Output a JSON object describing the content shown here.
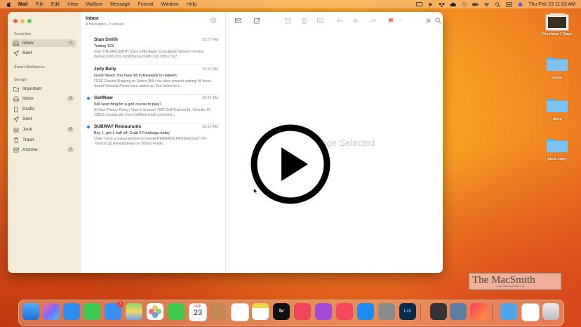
{
  "menubar": {
    "app": "Mail",
    "menus": [
      "File",
      "Edit",
      "View",
      "Mailbox",
      "Message",
      "Format",
      "Window",
      "Help"
    ],
    "clock": "Thu Feb 23  11:03 AM"
  },
  "sidebar": {
    "favorites_label": "Favorites",
    "favorites": [
      {
        "label": "Inbox",
        "badge": "2",
        "icon": "tray-icon"
      },
      {
        "label": "Sent",
        "badge": "",
        "icon": "paperplane-icon"
      }
    ],
    "smart_label": "Smart Mailboxes",
    "google_label": "Google",
    "google": [
      {
        "label": "Important",
        "badge": "",
        "icon": "folder-icon"
      },
      {
        "label": "Inbox",
        "badge": "2",
        "icon": "tray-icon"
      },
      {
        "label": "Drafts",
        "badge": "",
        "icon": "document-icon"
      },
      {
        "label": "Sent",
        "badge": "",
        "icon": "paperplane-icon"
      },
      {
        "label": "Junk",
        "badge": "8",
        "icon": "junk-icon"
      },
      {
        "label": "Trash",
        "badge": "",
        "icon": "trash-icon"
      },
      {
        "label": "Archive",
        "badge": "2",
        "icon": "archive-icon"
      }
    ]
  },
  "message_list": {
    "title": "Inbox",
    "subtitle": "4 messages, 2 unread",
    "messages": [
      {
        "from": "Stan Smith",
        "time": "10:27 AM",
        "subject": "Testing 123",
        "preview": "Stan THE MACSMITH Since 1999 Apple Consultants Network member themacsmith.com info@themacsmith.com Office: 917...",
        "unread": false
      },
      {
        "from": "Jelly Belly",
        "time": "10:33 AM",
        "subject": "Great News! You have $5 in Rewards to redeem.",
        "preview": "FREE Ground Shipping on Orders $55+You have rewards waiting! All those Sweet Rewards Points have added up! See below for t...",
        "unread": false
      },
      {
        "from": "GolfNow",
        "time": "10:22 AM",
        "subject": "Still searching for a golf course to play?",
        "preview": "Hi Stan Privacy Policy | View in browser 7580 Golf Channel Dr, Orlando, FL 32819 Unsubscribe from GolfNow email communic...",
        "unread": true
      },
      {
        "from": "SUBWAY Restaurants",
        "time": "10:31 AM",
        "subject": "Buy 1, get 1 half off: Grab 2 Footlongs today",
        "preview": "Order | Find a restaurantView in browserREWARDS PROGRESS0 / 200 Tokens0 $2 RewardsFeast on BOGO Footlo...",
        "unread": true
      }
    ]
  },
  "viewer": {
    "empty_text": "No Message Selected"
  },
  "desktop": {
    "icons": [
      {
        "label": "Previous 7 Days"
      },
      {
        "label": "class"
      },
      {
        "label": "picts"
      },
      {
        "label": "picts copy"
      }
    ]
  },
  "watermark": {
    "title": "The MacSmith",
    "sub": "www.themacsmith.com"
  },
  "dock": {
    "calendar_month": "FEB",
    "calendar_day": "23",
    "mail_badge": "2",
    "lrc_label": "Lrc",
    "appletv_label": "tv"
  },
  "colors": {
    "accent": "#2a7de1",
    "sidebar_bg": "#f2ecd8",
    "flag": "#f47a5a"
  }
}
